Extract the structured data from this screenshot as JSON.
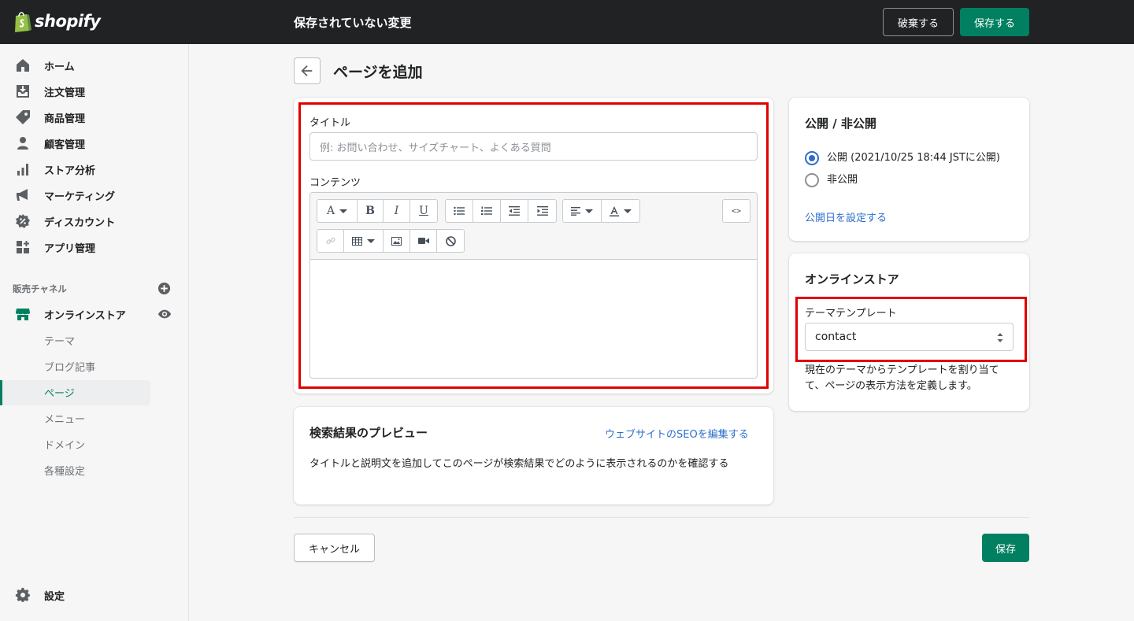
{
  "topbar": {
    "logo_text": "shopify",
    "status_text": "保存されていない変更",
    "discard_label": "破棄する",
    "save_label": "保存する"
  },
  "sidebar": {
    "items": [
      {
        "label": "ホーム",
        "icon": "home-icon"
      },
      {
        "label": "注文管理",
        "icon": "orders-icon"
      },
      {
        "label": "商品管理",
        "icon": "tag-icon"
      },
      {
        "label": "顧客管理",
        "icon": "customer-icon"
      },
      {
        "label": "ストア分析",
        "icon": "analytics-icon"
      },
      {
        "label": "マーケティング",
        "icon": "megaphone-icon"
      },
      {
        "label": "ディスカウント",
        "icon": "discount-icon"
      },
      {
        "label": "アプリ管理",
        "icon": "apps-icon"
      }
    ],
    "channels_label": "販売チャネル",
    "online_store_label": "オンラインストア",
    "sub_items": [
      "テーマ",
      "ブログ記事",
      "ページ",
      "メニュー",
      "ドメイン",
      "各種設定"
    ],
    "active_sub_item": "ページ",
    "settings_label": "設定"
  },
  "page": {
    "title": "ページを追加"
  },
  "content_card": {
    "title_label": "タイトル",
    "title_placeholder": "例: お問い合わせ、サイズチャート、よくある質問",
    "content_label": "コンテンツ",
    "toolbar_row1": [
      "A",
      "B",
      "I",
      "U"
    ],
    "html_toggle": "<>"
  },
  "seo_card": {
    "title": "検索結果のプレビュー",
    "edit_link": "ウェブサイトのSEOを編集する",
    "description": "タイトルと説明文を追加してこのページが検索結果でどのように表示されるのかを確認する"
  },
  "visibility_card": {
    "title": "公開 / 非公開",
    "options": [
      {
        "label": "公開 (2021/10/25 18:44 JSTに公開)",
        "selected": true
      },
      {
        "label": "非公開",
        "selected": false
      }
    ],
    "set_date_link": "公開日を設定する"
  },
  "store_card": {
    "title": "オンラインストア",
    "template_label": "テーマテンプレート",
    "template_value": "contact",
    "help_text": "現在のテーマからテンプレートを割り当てて、ページの表示方法を定義します。"
  },
  "footer": {
    "cancel_label": "キャンセル",
    "save_label": "保存"
  },
  "colors": {
    "primary": "#008060",
    "topbar": "#202223",
    "link": "#2c6ecb",
    "highlight": "#e00000"
  }
}
